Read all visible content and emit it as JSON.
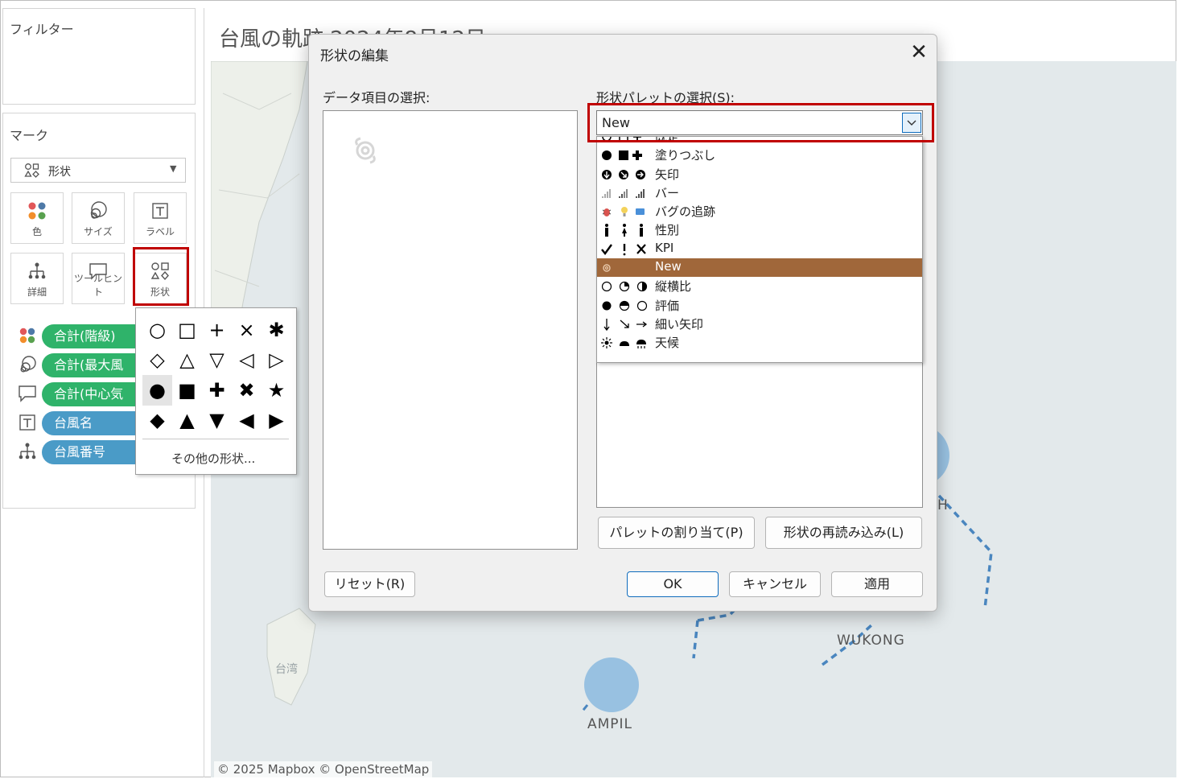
{
  "filters": {
    "title": "フィルター"
  },
  "marks": {
    "title": "マーク",
    "type_label": "形状",
    "buttons": [
      {
        "label": "色",
        "icon": "color-dots-icon"
      },
      {
        "label": "サイズ",
        "icon": "size-icon"
      },
      {
        "label": "ラベル",
        "icon": "label-icon"
      },
      {
        "label": "詳細",
        "icon": "detail-icon"
      },
      {
        "label": "ツールヒント",
        "icon": "tooltip-icon"
      },
      {
        "label": "形状",
        "icon": "shape-icon"
      }
    ],
    "pills": [
      {
        "label": "合計(階級)",
        "icon": "color-dots-icon",
        "color": "#2fb36a"
      },
      {
        "label": "合計(最大風",
        "icon": "size-icon",
        "color": "#2fb36a"
      },
      {
        "label": "合計(中心気",
        "icon": "tooltip-icon",
        "color": "#2fb36a"
      },
      {
        "label": "台風名",
        "icon": "label-icon",
        "color": "#4a9bc7"
      },
      {
        "label": "台風番号",
        "icon": "detail-icon",
        "color": "#4a9bc7"
      }
    ]
  },
  "shape_popup": {
    "rows": [
      [
        "○",
        "□",
        "+",
        "×",
        "✱"
      ],
      [
        "◇",
        "△",
        "▽",
        "◁",
        "▷"
      ],
      [
        "●",
        "■",
        "✚",
        "✖",
        "★"
      ],
      [
        "◆",
        "▲",
        "▼",
        "◀",
        "▶"
      ]
    ],
    "more_label": "その他の形状..."
  },
  "map": {
    "title": "台風の軌跡 2024年8月12日",
    "labels": {
      "ampil": "AMPIL",
      "wukong": "WUKONG",
      "taiwan": "台湾",
      "h": "H"
    },
    "attribution": "© 2025 Mapbox © OpenStreetMap",
    "bubble_color": "#8fbde0",
    "track_color": "#4a86bf"
  },
  "dialog": {
    "title": "形状の編集",
    "data_item_label": "データ項目の選択:",
    "palette_label": "形状パレットの選択(S):",
    "palette_selected": "New",
    "palette_options": [
      {
        "label": "既定",
        "icons": "○ □ +"
      },
      {
        "label": "塗りつぶし",
        "icons": "● ■ ✚"
      },
      {
        "label": "矢印",
        "icons": "arrow-circles"
      },
      {
        "label": "バー",
        "icons": "bar-icons"
      },
      {
        "label": "バグの追跡",
        "icons": "bug-icons"
      },
      {
        "label": "性別",
        "icons": "gender-icons"
      },
      {
        "label": "KPI",
        "icons": "✔ ! ✕"
      },
      {
        "label": "New",
        "icons": "typhoon-icon"
      },
      {
        "label": "縦横比",
        "icons": "ratio-icons"
      },
      {
        "label": "評価",
        "icons": "rating-icons"
      },
      {
        "label": "細い矢印",
        "icons": "thin-arrow-icons"
      },
      {
        "label": "天候",
        "icons": "weather-icons"
      }
    ],
    "buttons": {
      "assign_palette": "パレットの割り当て(P)",
      "reload_shapes": "形状の再読み込み(L)",
      "reset": "リセット(R)",
      "ok": "OK",
      "cancel": "キャンセル",
      "apply": "適用"
    },
    "highlight_color": "#a0673a"
  }
}
